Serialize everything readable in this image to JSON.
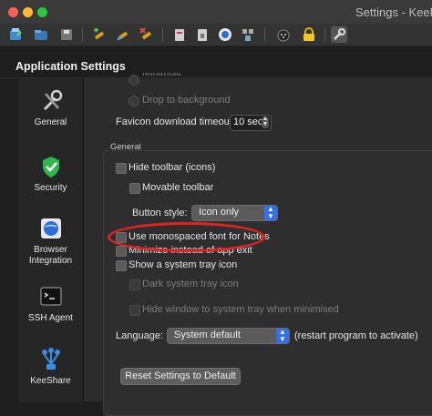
{
  "window": {
    "title": "Settings - KeeP"
  },
  "toolbar": {
    "icons": [
      "database-new-icon",
      "database-open-icon",
      "database-save-icon",
      "entry-add-icon",
      "entry-edit-icon",
      "entry-delete-icon",
      "copy-username-icon",
      "copy-password-icon",
      "url-open-icon",
      "groups-icon",
      "password-generator-icon",
      "lock-icon",
      "settings-icon"
    ]
  },
  "app": {
    "title": "Application Settings"
  },
  "sidebar": {
    "items": [
      {
        "label": "General"
      },
      {
        "label": "Security"
      },
      {
        "label": "Browser Integration"
      },
      {
        "label": "SSH Agent"
      },
      {
        "label": "KeeShare"
      }
    ]
  },
  "top": {
    "partial_option": "Minimise",
    "drop_to_background": "Drop to background",
    "favicon_label": "Favicon download timeout:",
    "favicon_value": "10 sec"
  },
  "general": {
    "group_title": "General",
    "hide_toolbar": "Hide toolbar (icons)",
    "movable_toolbar": "Movable toolbar",
    "button_style_label": "Button style:",
    "button_style_value": "Icon only",
    "monospaced": "Use monospaced font for Notes",
    "minimize_on_exit": "Minimize instead of app exit",
    "show_tray": "Show a system tray icon",
    "dark_tray": "Dark system tray icon",
    "hide_window": "Hide window to system tray when minimised",
    "language_label": "Language:",
    "language_value": "System default",
    "restart_note": "(restart program to activate)",
    "reset_button": "Reset Settings to Default"
  },
  "colors": {
    "highlight_ellipse": "#e52222",
    "accent": "#2f6ff0"
  }
}
